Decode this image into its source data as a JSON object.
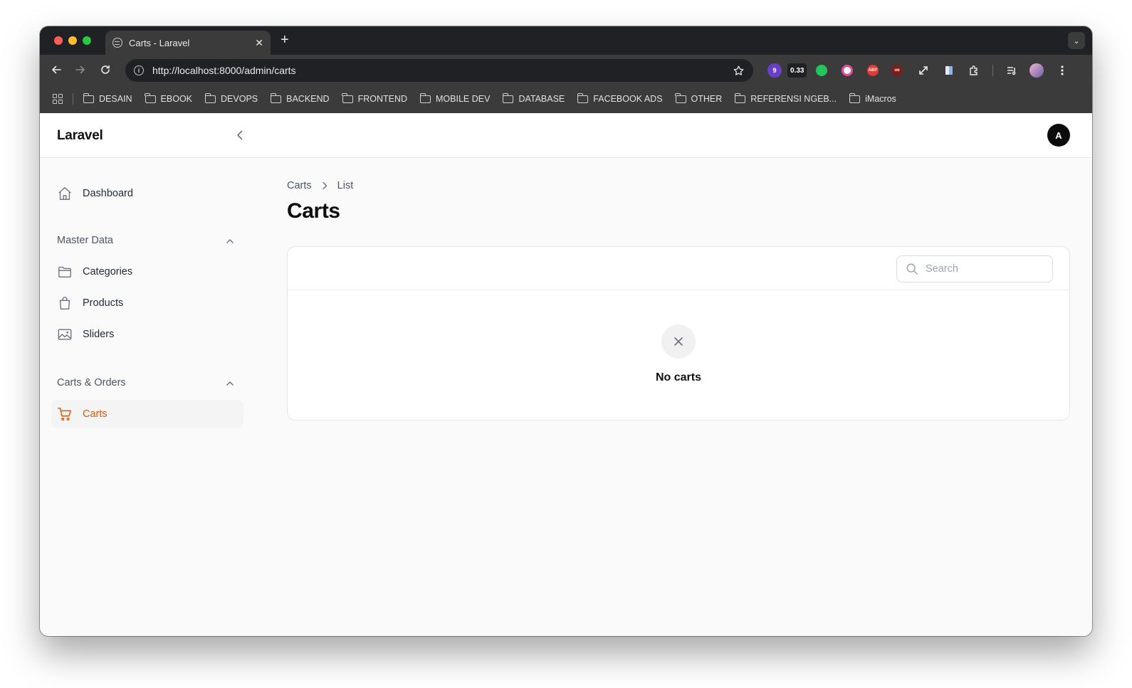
{
  "browser": {
    "tab_title": "Carts - Laravel",
    "tab_close": "✕",
    "new_tab": "+",
    "tabs_menu": "⌄",
    "url": "http://localhost:8000/admin/carts",
    "extensions": {
      "badge_count": "9",
      "metric": "0.33",
      "abp": "ABP",
      "ublock": "uo"
    },
    "bookmarks": [
      "DESAIN",
      "EBOOK",
      "DEVOPS",
      "BACKEND",
      "FRONTEND",
      "MOBILE DEV",
      "DATABASE",
      "FACEBOOK ADS",
      "OTHER",
      "REFERENSI NGEB...",
      "iMacros"
    ]
  },
  "header": {
    "brand": "Laravel",
    "avatar_initial": "A"
  },
  "sidebar": {
    "dashboard": "Dashboard",
    "groups": [
      {
        "label": "Master Data",
        "items": [
          "Categories",
          "Products",
          "Sliders"
        ]
      },
      {
        "label": "Carts & Orders",
        "items": [
          "Carts"
        ]
      }
    ],
    "active_item": "Carts"
  },
  "main": {
    "breadcrumb": [
      "Carts",
      "List"
    ],
    "title": "Carts",
    "search": {
      "placeholder": "Search",
      "value": ""
    },
    "empty_text": "No carts"
  },
  "colors": {
    "accent": "#d9570b",
    "chrome_dark": "#202124",
    "chrome_toolbar": "#3b3b3b"
  }
}
